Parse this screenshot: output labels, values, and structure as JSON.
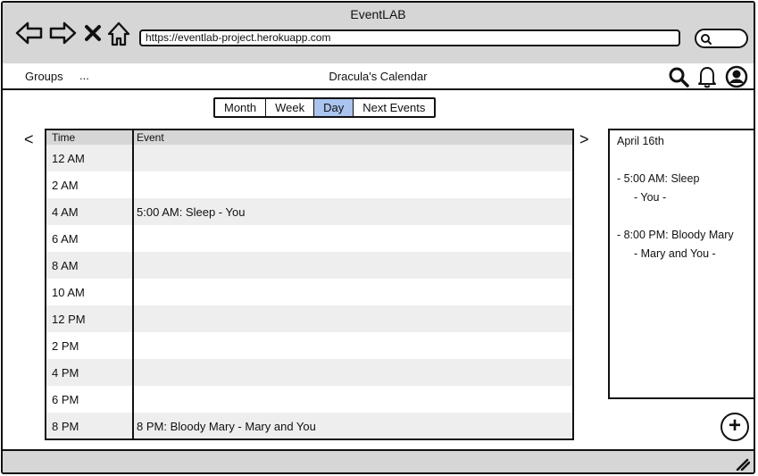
{
  "window": {
    "title": "EventLAB"
  },
  "browser": {
    "url": "https://eventlab-project.herokuapp.com",
    "search_placeholder": ""
  },
  "navbar": {
    "groups_label": "Groups",
    "more_label": "...",
    "title": "Dracula's Calendar"
  },
  "view_tabs": [
    {
      "label": "Month",
      "active": false
    },
    {
      "label": "Week",
      "active": false
    },
    {
      "label": "Day",
      "active": true
    },
    {
      "label": "Next Events",
      "active": false
    }
  ],
  "day_table": {
    "columns": [
      "Time",
      "Event"
    ],
    "rows": [
      {
        "time": "12 AM",
        "event": ""
      },
      {
        "time": "2 AM",
        "event": ""
      },
      {
        "time": "4 AM",
        "event": "5:00 AM: Sleep - You"
      },
      {
        "time": "6 AM",
        "event": ""
      },
      {
        "time": "8 AM",
        "event": ""
      },
      {
        "time": "10 AM",
        "event": ""
      },
      {
        "time": "12 PM",
        "event": ""
      },
      {
        "time": "2 PM",
        "event": ""
      },
      {
        "time": "4 PM",
        "event": ""
      },
      {
        "time": "6 PM",
        "event": ""
      },
      {
        "time": "8 PM",
        "event": "8 PM: Bloody Mary - Mary and You"
      }
    ]
  },
  "side_panel": {
    "date": "April 16th",
    "events": [
      {
        "line": "- 5:00 AM:  Sleep",
        "attendees": "- You -"
      },
      {
        "line": "- 8:00 PM:  Bloody Mary",
        "attendees": "- Mary and You -"
      }
    ]
  },
  "icons": {
    "back": "back-arrow-icon",
    "forward": "forward-arrow-icon",
    "stop": "close-icon",
    "home": "home-icon",
    "search": "search-icon",
    "bell": "bell-icon",
    "user": "user-icon",
    "prev": "chevron-left-icon",
    "next": "chevron-right-icon",
    "add": "plus-icon",
    "resize": "resize-grip-icon"
  },
  "controls": {
    "prev_glyph": "<",
    "next_glyph": ">",
    "add_glyph": "+"
  }
}
